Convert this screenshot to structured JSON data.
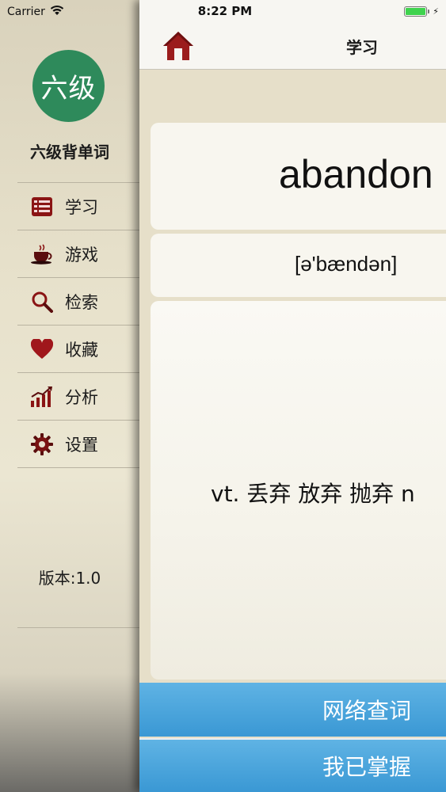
{
  "status_bar": {
    "carrier": "Carrier",
    "time": "8:22 PM",
    "battery_level": 1.0
  },
  "sidebar": {
    "avatar_text": "六级",
    "app_name": "六级背单词",
    "items": [
      {
        "label": "学习",
        "icon": "book-list-icon"
      },
      {
        "label": "游戏",
        "icon": "coffee-cup-icon"
      },
      {
        "label": "检索",
        "icon": "magnifier-icon"
      },
      {
        "label": "收藏",
        "icon": "heart-icon"
      },
      {
        "label": "分析",
        "icon": "bar-chart-icon"
      },
      {
        "label": "设置",
        "icon": "gear-icon"
      }
    ],
    "version": "版本:1.0"
  },
  "main": {
    "title": "学习",
    "word": "abandon",
    "phonetic": "[ə'bændən]",
    "meaning": "vt. 丢弃 放弃 抛弃 n",
    "buttons": {
      "lookup": "网络查词",
      "mastered": "我已掌握"
    }
  },
  "colors": {
    "accent_blue": "#4aa5dc",
    "avatar_green": "#2e8a5b",
    "home_red": "#9b1c1c",
    "battery_green": "#3fd34e"
  }
}
